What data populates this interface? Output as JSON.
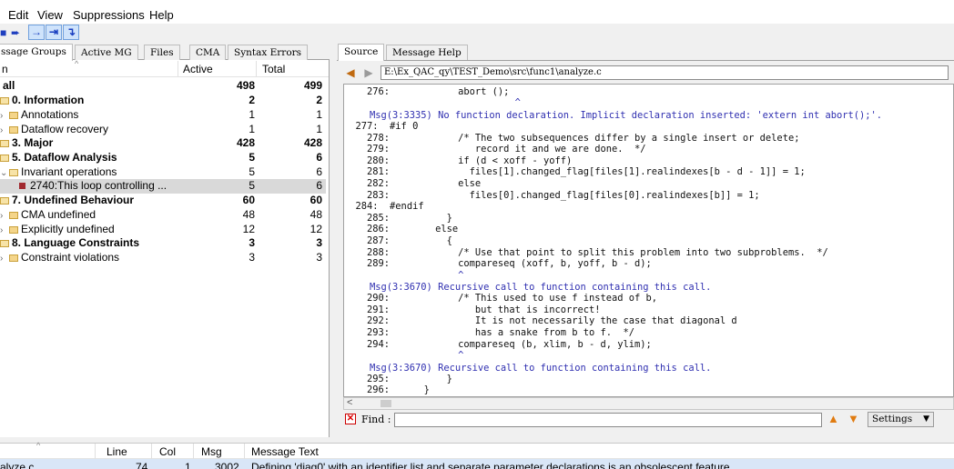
{
  "menu": [
    "Edit",
    "View",
    "Suppressions",
    "Help"
  ],
  "left_tabs": [
    "ssage Groups",
    "Active MG",
    "Files",
    "CMA",
    "Syntax Errors"
  ],
  "tree_header": {
    "name": "n",
    "active": "Active",
    "total": "Total"
  },
  "tree": [
    {
      "label": "all",
      "active": "498",
      "total": "499",
      "bold": true
    },
    {
      "label": "0. Information",
      "active": "2",
      "total": "2",
      "bold": true
    },
    {
      "label": "Annotations",
      "active": "1",
      "total": "1",
      "bold": false
    },
    {
      "label": "Dataflow recovery",
      "active": "1",
      "total": "1",
      "bold": false
    },
    {
      "label": "3. Major",
      "active": "428",
      "total": "428",
      "bold": true
    },
    {
      "label": "5. Dataflow Analysis",
      "active": "5",
      "total": "6",
      "bold": true
    },
    {
      "label": "Invariant operations",
      "active": "5",
      "total": "6",
      "bold": false
    },
    {
      "label": "2740:This loop controlling ...",
      "active": "5",
      "total": "6",
      "bold": false
    },
    {
      "label": "7. Undefined Behaviour",
      "active": "60",
      "total": "60",
      "bold": true
    },
    {
      "label": "CMA undefined",
      "active": "48",
      "total": "48",
      "bold": false
    },
    {
      "label": "Explicitly undefined",
      "active": "12",
      "total": "12",
      "bold": false
    },
    {
      "label": "8. Language Constraints",
      "active": "3",
      "total": "3",
      "bold": true
    },
    {
      "label": "Constraint violations",
      "active": "3",
      "total": "3",
      "bold": false
    }
  ],
  "right_tabs": [
    "Source",
    "Message Help"
  ],
  "file_path": "E:\\Ex_QAC_qy\\TEST_Demo\\src\\func1\\analyze.c",
  "code_lines": [
    {
      "text": "    276:            abort ();",
      "kind": "code"
    },
    {
      "text": "                              ^",
      "kind": "msg"
    },
    {
      "text": "Msg(3:3335) No function declaration. Implicit declaration inserted: 'extern int abort();'.",
      "kind": "msg"
    },
    {
      "text": "  277:  #if 0",
      "kind": "code"
    },
    {
      "text": "    278:            /* The two subsequences differ by a single insert or delete;",
      "kind": "code"
    },
    {
      "text": "    279:               record it and we are done.  */",
      "kind": "code"
    },
    {
      "text": "    280:            if (d < xoff - yoff)",
      "kind": "code"
    },
    {
      "text": "    281:              files[1].changed_flag[files[1].realindexes[b - d - 1]] = 1;",
      "kind": "code"
    },
    {
      "text": "    282:            else",
      "kind": "code"
    },
    {
      "text": "    283:              files[0].changed_flag[files[0].realindexes[b]] = 1;",
      "kind": "code"
    },
    {
      "text": "  284:  #endif",
      "kind": "code"
    },
    {
      "text": "    285:          }",
      "kind": "code"
    },
    {
      "text": "    286:        else",
      "kind": "code"
    },
    {
      "text": "    287:          {",
      "kind": "code"
    },
    {
      "text": "    288:            /* Use that point to split this problem into two subproblems.  */",
      "kind": "code"
    },
    {
      "text": "    289:            compareseq (xoff, b, yoff, b - d);",
      "kind": "code"
    },
    {
      "text": "                    ^",
      "kind": "msg"
    },
    {
      "text": "Msg(3:3670) Recursive call to function containing this call.",
      "kind": "msg"
    },
    {
      "text": "    290:            /* This used to use f instead of b,",
      "kind": "code"
    },
    {
      "text": "    291:               but that is incorrect!",
      "kind": "code"
    },
    {
      "text": "    292:               It is not necessarily the case that diagonal d",
      "kind": "code"
    },
    {
      "text": "    293:               has a snake from b to f.  */",
      "kind": "code"
    },
    {
      "text": "    294:            compareseq (b, xlim, b - d, ylim);",
      "kind": "code"
    },
    {
      "text": "                    ^",
      "kind": "msg"
    },
    {
      "text": "Msg(3:3670) Recursive call to function containing this call.",
      "kind": "msg"
    },
    {
      "text": "    295:          }",
      "kind": "code"
    },
    {
      "text": "    296:      }",
      "kind": "code"
    }
  ],
  "find": {
    "label": "Find :",
    "value": ""
  },
  "settings_label": "Settings",
  "bottom_header": {
    "line": "Line",
    "col": "Col",
    "msg": "Msg",
    "text": "Message Text"
  },
  "bottom_row": {
    "file": "alyze.c",
    "line": "74",
    "col": "1",
    "msg": "3002",
    "text": "Defining 'diag0' with an identifier list and separate parameter declarations is an obsolescent feature."
  },
  "colors": {
    "selected_row": "#d9d9d9",
    "message_text": "#2f2fb0",
    "bottom_selection": "#d9e6f7"
  }
}
